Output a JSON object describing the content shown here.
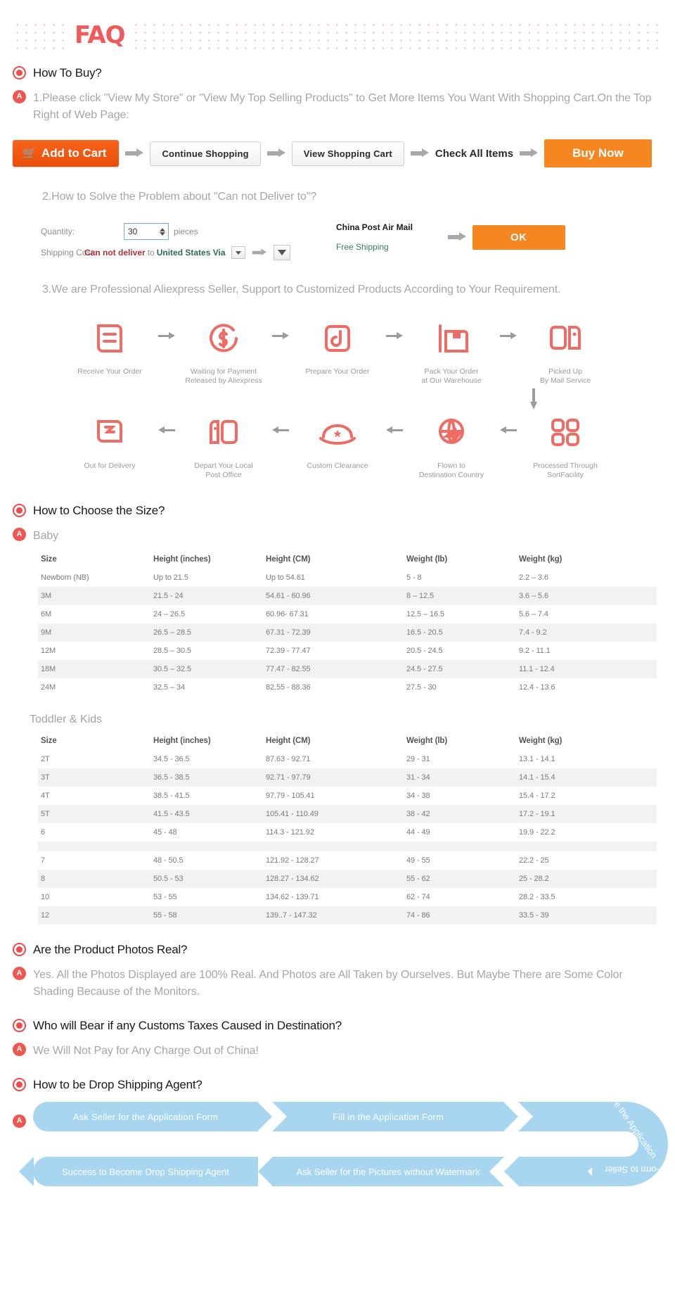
{
  "banner": {
    "title": "FAQ"
  },
  "q1": {
    "question": "How To Buy?",
    "answer1": "1.Please click \"View My Store\" or \"View My Top Selling Products\" to Get More Items You Want With Shopping Cart.On the Top Right of Web Page:",
    "buttons": {
      "add_to_cart": "Add to Cart",
      "continue_shopping": "Continue Shopping",
      "view_shopping_cart": "View Shopping Cart",
      "check_all_items": "Check All Items",
      "buy_now": "Buy Now"
    },
    "answer2": "2.How to Solve the Problem about \"Can not Deliver to\"?",
    "form": {
      "quantity_label": "Quantity:",
      "quantity_value": "30",
      "pieces_label": "pieces",
      "shipping_label": "Shipping Cost:",
      "cannot_deliver": "Can not deliver",
      "to_word": "to",
      "destination": "United States Via",
      "method_name": "China Post Air Mail",
      "method_price": "Free Shipping",
      "ok_label": "OK"
    },
    "answer3": "3.We are Professional Aliexpress Seller, Support to Customized Products According to Your Requirement.",
    "flow_row1": [
      {
        "icon": "document-icon",
        "label": "Receive Your Order"
      },
      {
        "icon": "dollar-circle-icon",
        "label": "Waiting for Payment\nReleased by Aliexpress"
      },
      {
        "icon": "scissors-box-icon",
        "label": "Prepare Your Order"
      },
      {
        "icon": "package-box-icon",
        "label": "Pack Your Order\nat Our Warehouse"
      },
      {
        "icon": "mailbox-icon",
        "label": "Picked Up\nBy Mail Service"
      }
    ],
    "flow_row2": [
      {
        "icon": "delivery-truck-icon",
        "label": "Out for Delivery"
      },
      {
        "icon": "post-office-icon",
        "label": "Depart Your Local\nPost Office"
      },
      {
        "icon": "customs-hat-icon",
        "label": "Custom Clearance"
      },
      {
        "icon": "globe-plane-icon",
        "label": "Flown to\nDestination Country"
      },
      {
        "icon": "sort-facility-icon",
        "label": "Processed Through\nSortFacility"
      }
    ]
  },
  "q2": {
    "question": "How to Choose the Size?",
    "baby_heading": "Baby",
    "kids_heading": "Toddler & Kids",
    "columns": [
      "Size",
      "Height (inches)",
      "Height (CM)",
      "Weight (lb)",
      "Weight (kg)"
    ],
    "baby_rows": [
      [
        "Newborn (NB)",
        "Up to 21.5",
        "Up to 54.61",
        "5 - 8",
        "2.2 – 3.6"
      ],
      [
        "3M",
        "21.5 - 24",
        "54.61 - 60.96",
        "8 – 12.5",
        "3.6 – 5.6"
      ],
      [
        "6M",
        "24 – 26.5",
        "60.96- 67.31",
        "12.5 – 16.5",
        "5.6 – 7.4"
      ],
      [
        "9M",
        "26.5 – 28.5",
        "67.31 - 72.39",
        "16.5 - 20.5",
        "7.4 - 9.2"
      ],
      [
        "12M",
        "28.5 – 30.5",
        "72.39 - 77.47",
        "20.5 - 24.5",
        "9.2 - 11.1"
      ],
      [
        "18M",
        "30.5 – 32.5",
        "77.47 - 82.55",
        "24.5 - 27.5",
        "11.1 - 12.4"
      ],
      [
        "24M",
        "32.5 – 34",
        "82.55 - 88.36",
        "27.5 - 30",
        "12.4 - 13.6"
      ]
    ],
    "kids_rows": [
      [
        "2T",
        "34.5 - 36.5",
        "87.63 - 92.71",
        "29 - 31",
        "13.1 - 14.1"
      ],
      [
        "3T",
        "36.5 - 38.5",
        "92.71 - 97.79",
        "31 - 34",
        "14.1 - 15.4"
      ],
      [
        "4T",
        "38.5 - 41.5",
        "97.79 - 105.41",
        "34 - 38",
        "15.4 - 17.2"
      ],
      [
        "5T",
        "41.5 - 43.5",
        "105.41 - 110.49",
        "38 - 42",
        "17.2 - 19.1"
      ],
      [
        "6",
        "45 - 48",
        "114.3 - 121.92",
        "44 - 49",
        "19.9 - 22.2"
      ],
      [
        "",
        "",
        "",
        "",
        ""
      ],
      [
        "7",
        "48 - 50.5",
        "121.92 - 128.27",
        "49 - 55",
        "22.2 - 25"
      ],
      [
        "8",
        "50.5 - 53",
        "128.27 - 134.62",
        "55 - 62",
        "25 - 28.2"
      ],
      [
        "10",
        "53 - 55",
        "134.62 - 139.71",
        "62 - 74",
        "28.2 - 33.5"
      ],
      [
        "12",
        "55 - 58",
        "139..7 - 147.32",
        "74 - 86",
        "33.5 - 39"
      ]
    ]
  },
  "q3": {
    "question": "Are the Product Photos Real?",
    "answer": "Yes. All the Photos Displayed are 100% Real. And Photos are All Taken by Ourselves. But Maybe There are Some Color Shading Because of the Monitors."
  },
  "q4": {
    "question": "Who will Bear if any Customs Taxes Caused in Destination?",
    "answer": "We Will Not Pay for Any Charge Out of China!"
  },
  "q5": {
    "question": "How to be Drop Shipping Agent?",
    "steps": [
      "Ask Seller for the Application Form",
      "Fill in the Application Form",
      "Give the Application",
      "Form to Seller",
      "Ask Seller for the Pictures without Watermark",
      "Success to Become Drop Shipping Agent"
    ]
  },
  "colors": {
    "accent_red": "#f0564f",
    "cart_orange": "#e94e09",
    "buy_orange": "#f68620",
    "ribbon_blue": "#a8d6f0",
    "muted_text": "#a6a6a6"
  }
}
